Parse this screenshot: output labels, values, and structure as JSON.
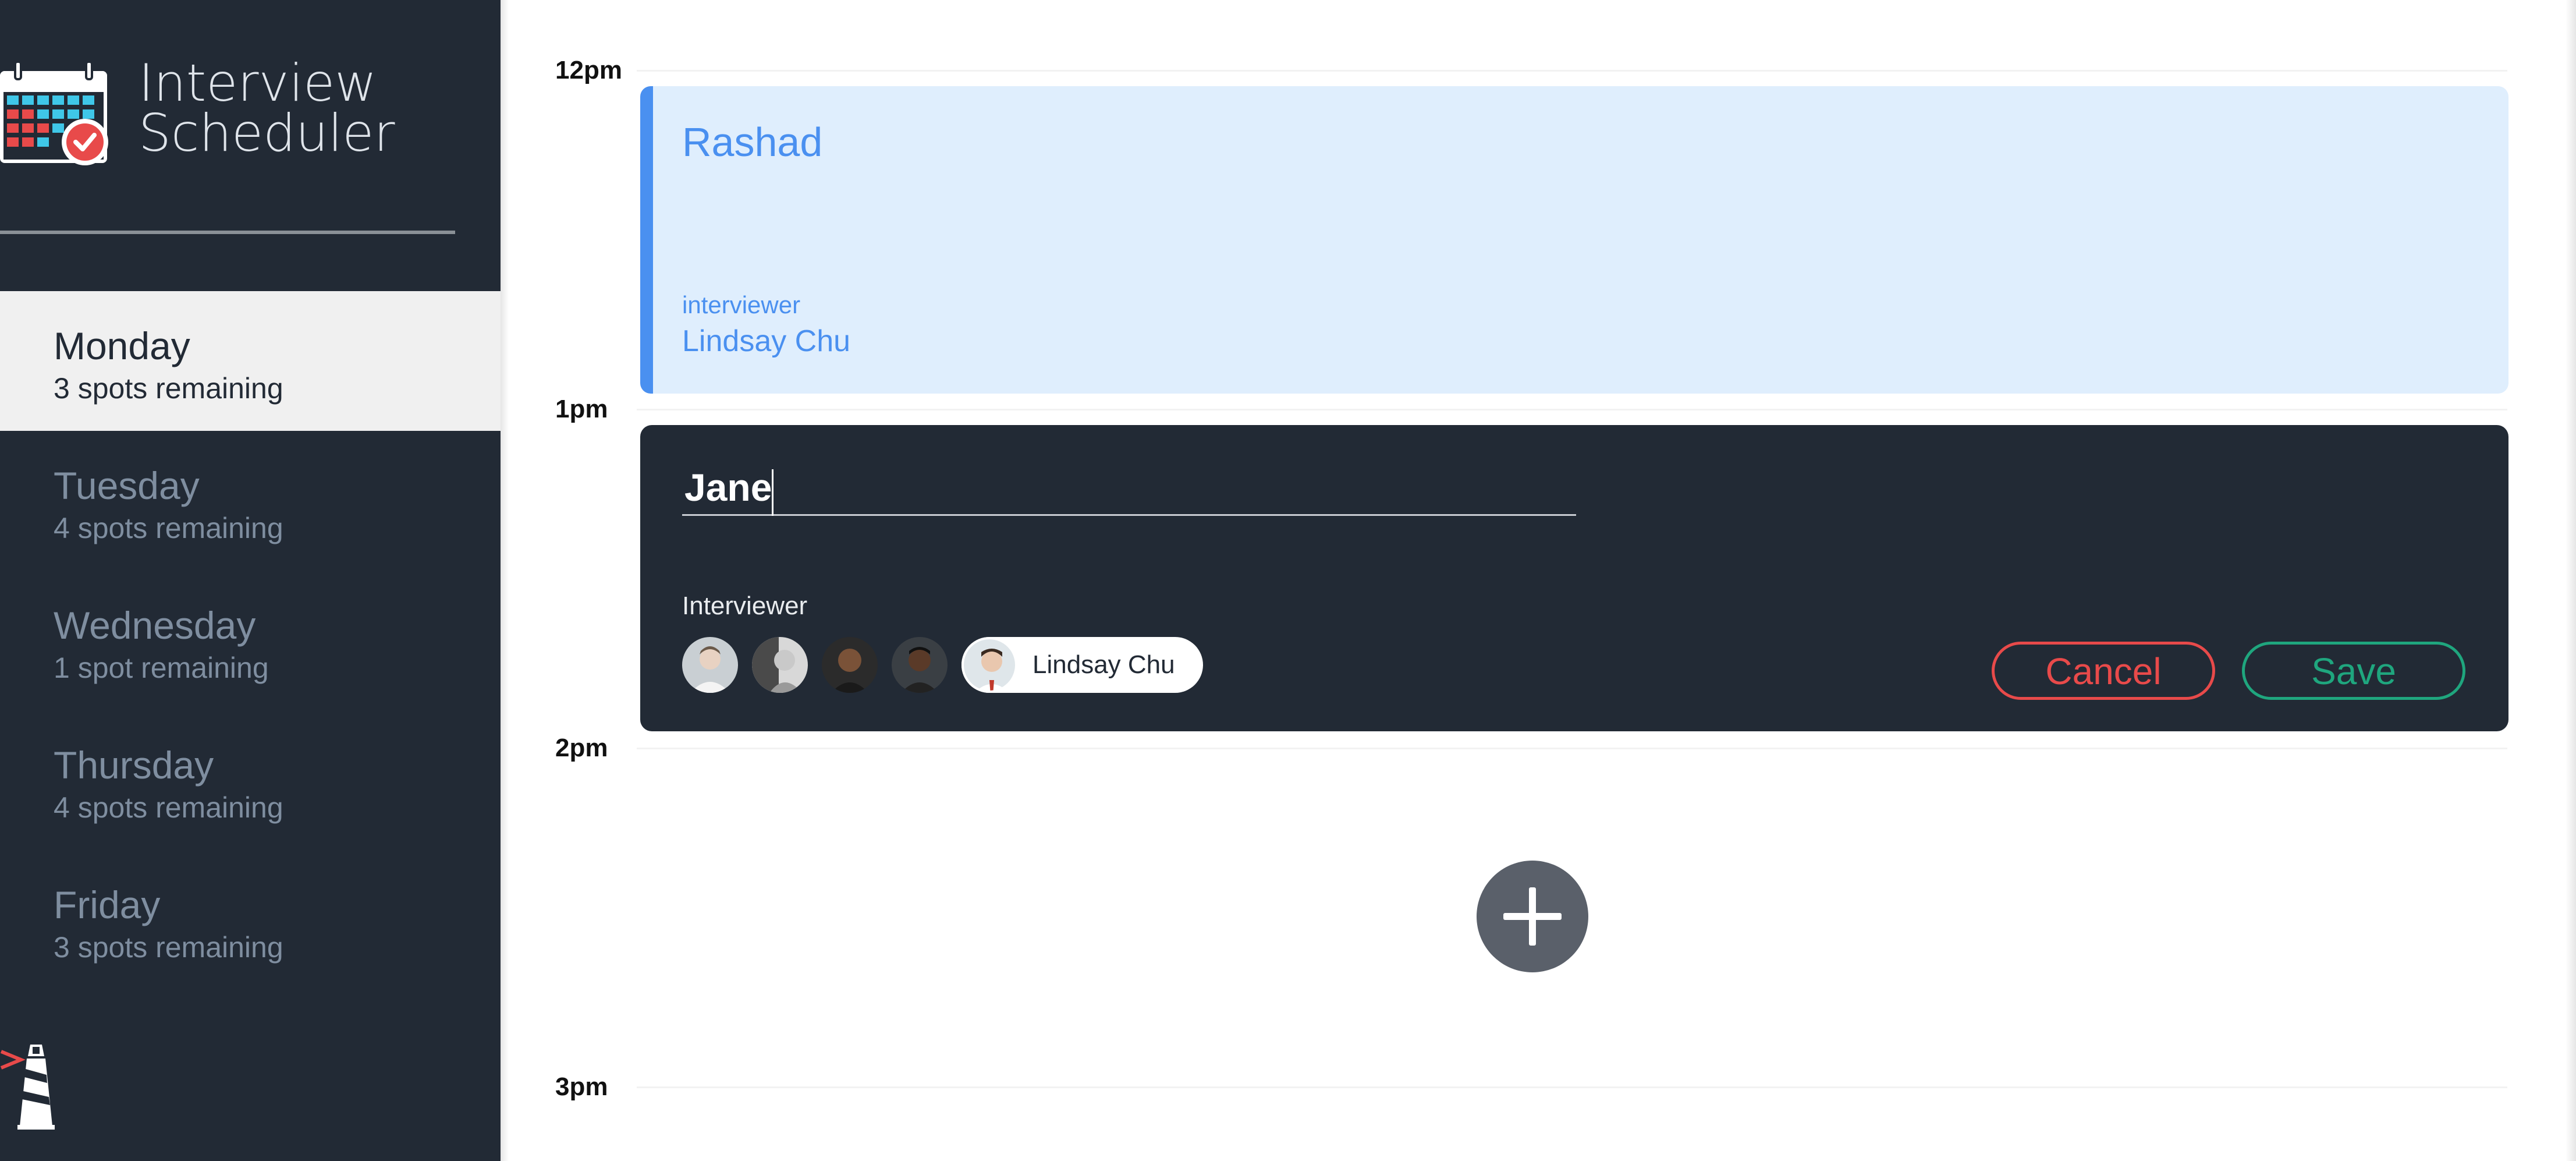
{
  "app": {
    "title_line1": "Interview",
    "title_line2": "Scheduler"
  },
  "sidebar": {
    "days": [
      {
        "name": "Monday",
        "spots": "3 spots remaining",
        "selected": true
      },
      {
        "name": "Tuesday",
        "spots": "4 spots remaining",
        "selected": false
      },
      {
        "name": "Wednesday",
        "spots": "1 spot remaining",
        "selected": false
      },
      {
        "name": "Thursday",
        "spots": "4 spots remaining",
        "selected": false
      },
      {
        "name": "Friday",
        "spots": "3 spots remaining",
        "selected": false
      }
    ]
  },
  "schedule": {
    "times": [
      "12pm",
      "1pm",
      "2pm",
      "3pm"
    ],
    "appointment": {
      "student": "Rashad",
      "interviewer_label": "interviewer",
      "interviewer_name": "Lindsay Chu"
    },
    "form": {
      "student_value": "Jane",
      "interviewer_label": "Interviewer",
      "selected_interviewer": "Lindsay Chu",
      "cancel_label": "Cancel",
      "save_label": "Save"
    }
  },
  "colors": {
    "sidebar_bg": "#222a35",
    "accent_blue": "#4a90f0",
    "appointment_bg": "#dfeefd",
    "cancel": "#e84a4a",
    "save": "#1fa67e"
  },
  "icons": {
    "logo": "calendar-check-icon",
    "footer": "lighthouse-icon",
    "add": "plus-icon"
  }
}
